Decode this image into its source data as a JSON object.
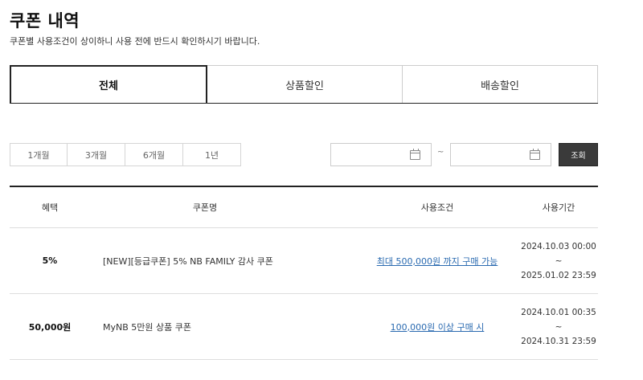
{
  "page": {
    "title": "쿠폰 내역",
    "description": "쿠폰별 사용조건이 상이하니 사용 전에 반드시 확인하시기 바랍니다."
  },
  "tabs": [
    {
      "label": "전체",
      "active": true
    },
    {
      "label": "상품할인",
      "active": false
    },
    {
      "label": "배송할인",
      "active": false
    }
  ],
  "filter": {
    "periods": [
      "1개월",
      "3개월",
      "6개월",
      "1년"
    ],
    "date_from": "",
    "date_to": "",
    "separator": "~",
    "search_label": "조회"
  },
  "table": {
    "headers": [
      "혜택",
      "쿠폰명",
      "사용조건",
      "사용기간"
    ],
    "rows": [
      {
        "benefit": "5%",
        "name": "[NEW][등급쿠폰] 5% NB FAMILY 감사 쿠폰",
        "condition": "최대 500,000원 까지 구매 가능",
        "period_start": "2024.10.03 00:00 ~",
        "period_end": "2025.01.02 23:59"
      },
      {
        "benefit": "50,000원",
        "name": "MyNB 5만원 상품 쿠폰",
        "condition": "100,000원 이상 구매 시",
        "period_start": "2024.10.01 00:35 ~",
        "period_end": "2024.10.31 23:59"
      }
    ]
  },
  "colors": {
    "link": "#2a6ab0",
    "search_button": "#3a3a3a",
    "border_dark": "#222222"
  }
}
